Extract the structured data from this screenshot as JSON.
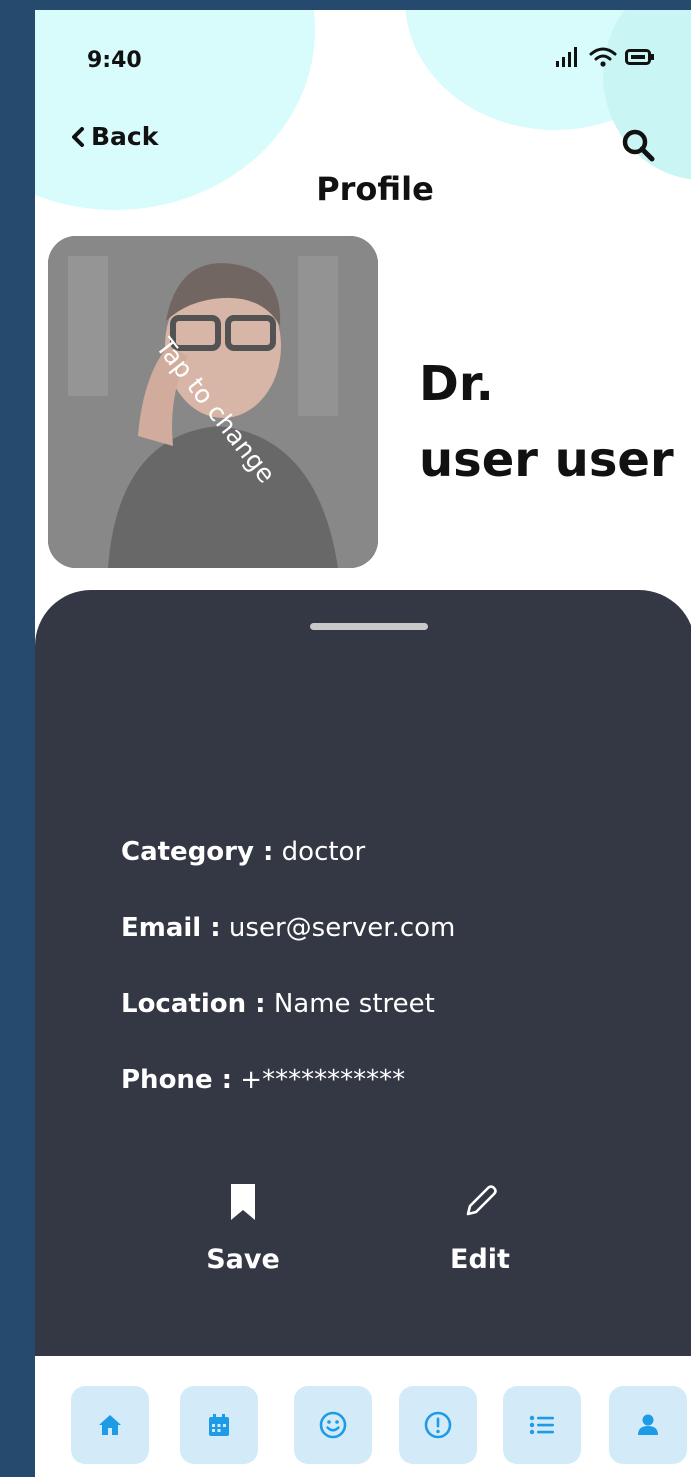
{
  "status": {
    "time": "9:40"
  },
  "header": {
    "back_label": "Back",
    "title": "Profile"
  },
  "photo": {
    "hint": "Tap to change"
  },
  "profile": {
    "prefix": "Dr.",
    "name": "user user"
  },
  "details": {
    "category_label": "Category :",
    "category_value": " doctor",
    "email_label": "Email :",
    "email_value": " user@server.com",
    "location_label": "Location :",
    "location_value": " Name street",
    "phone_label": "Phone :",
    "phone_value": " +***********"
  },
  "actions": {
    "save_label": "Save",
    "edit_label": "Edit"
  },
  "nav": {
    "items": [
      "home-icon",
      "calendar-icon",
      "smiley-icon",
      "alert-icon",
      "list-icon",
      "user-icon"
    ],
    "accent": "#1e9be6"
  }
}
